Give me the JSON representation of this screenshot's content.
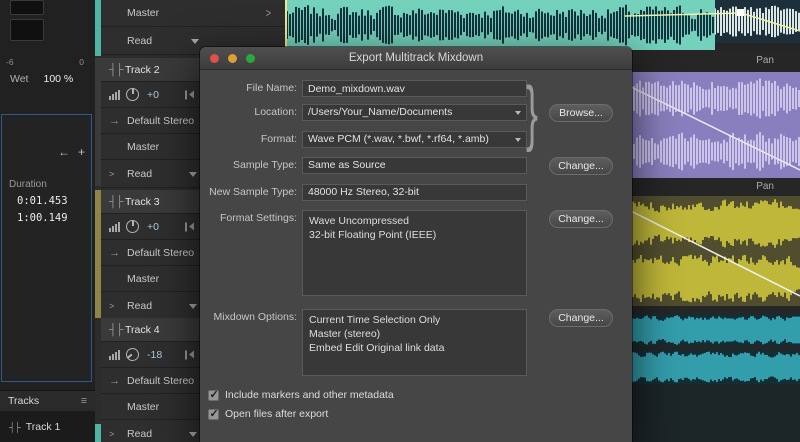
{
  "window": {
    "title": "Export Multitrack Mixdown"
  },
  "dialog": {
    "file_name": {
      "label": "File Name:",
      "value": "Demo_mixdown.wav"
    },
    "location": {
      "label": "Location:",
      "value": "/Users/Your_Name/Documents",
      "browse": "Browse..."
    },
    "format": {
      "label": "Format:",
      "value": "Wave PCM (*.wav, *.bwf, *.rf64, *.amb)"
    },
    "sample_type": {
      "label": "Sample Type:",
      "value": "Same as Source",
      "change": "Change..."
    },
    "new_sample_type": {
      "label": "New Sample Type:",
      "value": "48000 Hz Stereo, 32-bit"
    },
    "format_settings": {
      "label": "Format Settings:",
      "line1": "Wave Uncompressed",
      "line2": "32-bit Floating Point (IEEE)",
      "change": "Change..."
    },
    "mixdown_options": {
      "label": "Mixdown Options:",
      "line1": "Current Time Selection Only",
      "line2": "Master (stereo)",
      "line3": "Embed Edit Original link data",
      "change": "Change..."
    },
    "checkbox_markers": "Include markers and other metadata",
    "checkbox_open": "Open files after export"
  },
  "left_panel": {
    "scale_minus6": "-6",
    "scale_zero": "0",
    "wet_label": "Wet",
    "wet_value": "100 %",
    "duration_label": "Duration",
    "time_selection": "0:01.453",
    "time_total": "1:00.149",
    "tracks_header": "Tracks",
    "bottom_track_name": "Track 1"
  },
  "track_panel": {
    "master_label": "Master",
    "read_label": "Read",
    "tracks": [
      {
        "name": "Track 2",
        "gain": "+0",
        "output": "Default Stereo",
        "bus": "Master",
        "automation": "Read"
      },
      {
        "name": "Track 3",
        "gain": "+0",
        "output": "Default Stereo",
        "bus": "Master",
        "automation": "Read"
      },
      {
        "name": "Track 4",
        "gain": "-18",
        "output": "Default Stereo",
        "bus": "Master",
        "automation": "Read"
      }
    ]
  },
  "timeline": {
    "pan_label": "Pan"
  },
  "icons": {
    "chevron_right": ">",
    "menu": "≡",
    "track_glyph": "┤├",
    "back_arrow": "←",
    "plus": "+",
    "check": "✓",
    "brace": "}",
    "output_arrow": "→"
  },
  "colors": {
    "clip_teal": "#74d2bc",
    "clip_purple": "#8a7fbe",
    "wave_yellow": "#e4da3d",
    "wave_teal": "#3ec3d3",
    "selection_border": "#2e5a88"
  }
}
